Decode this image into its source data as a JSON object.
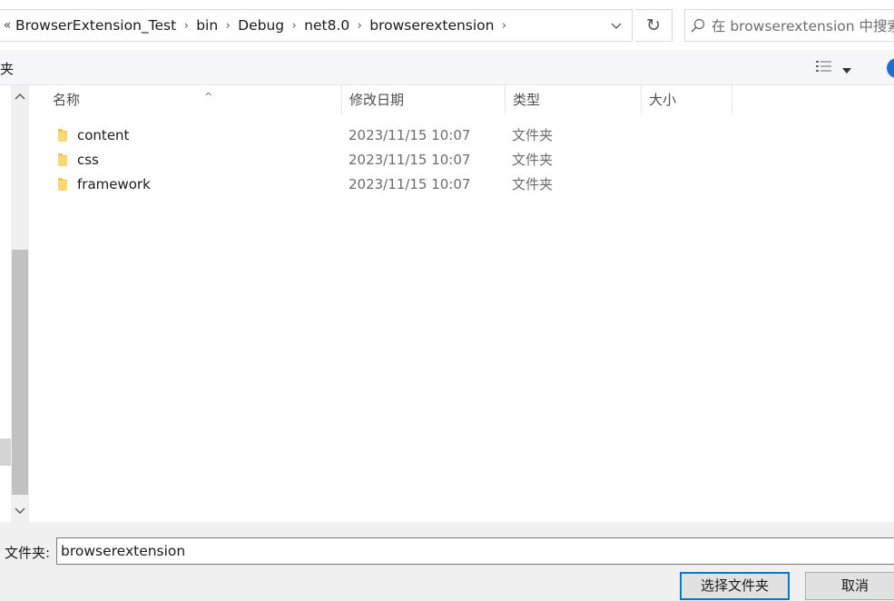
{
  "address_bar": {
    "overflow": "«",
    "crumbs": [
      "BrowserExtension_Test",
      "bin",
      "Debug",
      "net8.0",
      "browserextension"
    ],
    "dropdown_icon": "chevron-down-icon",
    "refresh_icon": "refresh-icon"
  },
  "search": {
    "placeholder": "在 browserextension 中搜索",
    "icon": "search-icon"
  },
  "toolbar": {
    "cut_label": "夹",
    "view_icon": "details-view-icon",
    "help_icon": "help-icon"
  },
  "columns": {
    "name": "名称",
    "date": "修改日期",
    "type": "类型",
    "size": "大小"
  },
  "files": [
    {
      "name": "content",
      "date": "2023/11/15 10:07",
      "type": "文件夹",
      "size": ""
    },
    {
      "name": "css",
      "date": "2023/11/15 10:07",
      "type": "文件夹",
      "size": ""
    },
    {
      "name": "framework",
      "date": "2023/11/15 10:07",
      "type": "文件夹",
      "size": ""
    }
  ],
  "footer": {
    "folder_label": "文件夹:",
    "folder_value": "browserextension",
    "select_button": "选择文件夹",
    "cancel_button": "取消"
  },
  "colors": {
    "accent": "#0078d7",
    "folder": "#f3c54b",
    "help": "#1b6fd1"
  }
}
